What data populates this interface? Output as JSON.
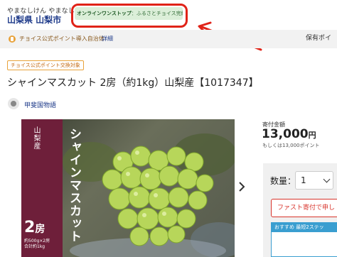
{
  "header": {
    "region_kana": "やまなしけん やまなしし",
    "region_name": "山梨県 山梨市",
    "onestop_prefix": "オンラインワンストップ",
    "onestop_suffix": "：ふるさとチョイス完結型"
  },
  "subbar": {
    "points_text": "チョイス公式ポイント導入自治体",
    "detail_link": "詳細",
    "right_text": "保有ポイ"
  },
  "product": {
    "tag": "チョイス公式ポイント交換対象",
    "title": "シャインマスカット 2房（約1kg）山梨産【1017347】",
    "provider": "甲斐国物語",
    "image_label": {
      "origin": "山梨産",
      "name": "シャインマスカット",
      "count_number": "2",
      "count_unit": "房",
      "detail": "約500g×2房\n合計約1kg"
    }
  },
  "donation": {
    "label": "寄付金額",
    "amount_number": "13,000",
    "amount_unit": "円",
    "points": "もしくは13,000ポイント"
  },
  "purchase": {
    "qty_label": "数量：",
    "qty_value": "1",
    "fast_button": "ファスト寄付で申し",
    "recommend": "おすすめ 最短2ステッ"
  },
  "colors": {
    "highlight_frame": "#e02318",
    "onestop_badge": "#dcefd9",
    "region_name": "#1f3b8a",
    "label_panel": "#6e1f3a",
    "fast_button": "#d8332b",
    "recommend": "#3a9ed0"
  },
  "icons": {
    "points": "coin-icon",
    "provider": "shop-icon",
    "next": "chevron-right-icon",
    "select": "chevron-down-icon"
  }
}
